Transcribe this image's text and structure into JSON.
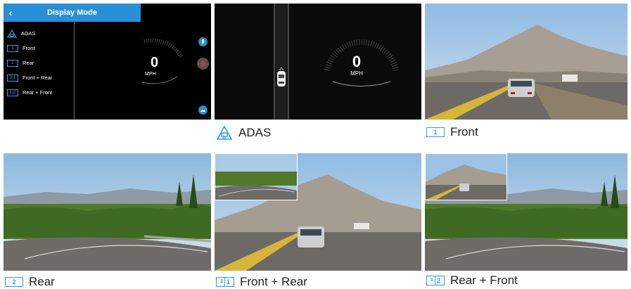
{
  "menu_panel": {
    "title": "Display Mode",
    "items": [
      {
        "badge": "",
        "label": "ADAS"
      },
      {
        "badge": "1",
        "label": "Front"
      },
      {
        "badge": "2",
        "label": "Rear"
      },
      {
        "badge": "2|1",
        "label": "Front + Rear"
      },
      {
        "badge": "1|2",
        "label": "Rear + Front"
      }
    ],
    "speed_value": "0",
    "speed_unit": "MPH"
  },
  "adas_panel": {
    "speed_value": "0",
    "speed_unit": "MPH"
  },
  "captions": {
    "adas": "ADAS",
    "front": "Front",
    "rear": "Rear",
    "front_rear": "Front + Rear",
    "rear_front": "Rear + Front"
  },
  "badges": {
    "front": "1",
    "rear": "2",
    "front_rear_a": "2",
    "front_rear_b": "1",
    "rear_front_a": "1",
    "rear_front_b": "2"
  },
  "colors": {
    "accent": "#2a8fd6",
    "record": "#e03030"
  }
}
